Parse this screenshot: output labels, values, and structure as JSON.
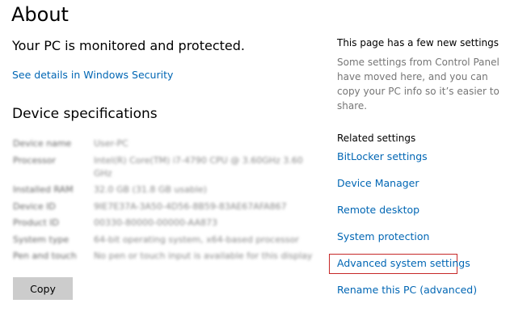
{
  "page": {
    "title": "About",
    "protection_status": "Your PC is monitored and protected.",
    "security_link": "See details in Windows Security"
  },
  "device_specifications": {
    "heading": "Device specifications",
    "rows": [
      {
        "label": "Device name",
        "value": "User-PC"
      },
      {
        "label": "Processor",
        "value": "Intel(R) Core(TM) i7-4790 CPU @ 3.60GHz   3.60 GHz"
      },
      {
        "label": "Installed RAM",
        "value": "32.0 GB (31.8 GB usable)"
      },
      {
        "label": "Device ID",
        "value": "9IE7E37A-3A50-4D56-8B59-83AE67AFA867"
      },
      {
        "label": "Product ID",
        "value": "00330-80000-00000-AA873"
      },
      {
        "label": "System type",
        "value": "64-bit operating system, x64-based processor"
      },
      {
        "label": "Pen and touch",
        "value": "No pen or touch input is available for this display"
      }
    ],
    "copy_button": "Copy"
  },
  "side_panel": {
    "new_settings_heading": "This page has a few new settings",
    "new_settings_text": "Some settings from Control Panel have moved here, and you can copy your PC info so it’s easier to share.",
    "related_heading": "Related settings",
    "related_links": [
      "BitLocker settings",
      "Device Manager",
      "Remote desktop",
      "System protection",
      "Advanced system settings",
      "Rename this PC (advanced)"
    ]
  },
  "colors": {
    "link": "#0066b4",
    "highlight_border": "#c62828",
    "button_bg": "#cccccc",
    "muted_text": "#767676"
  }
}
